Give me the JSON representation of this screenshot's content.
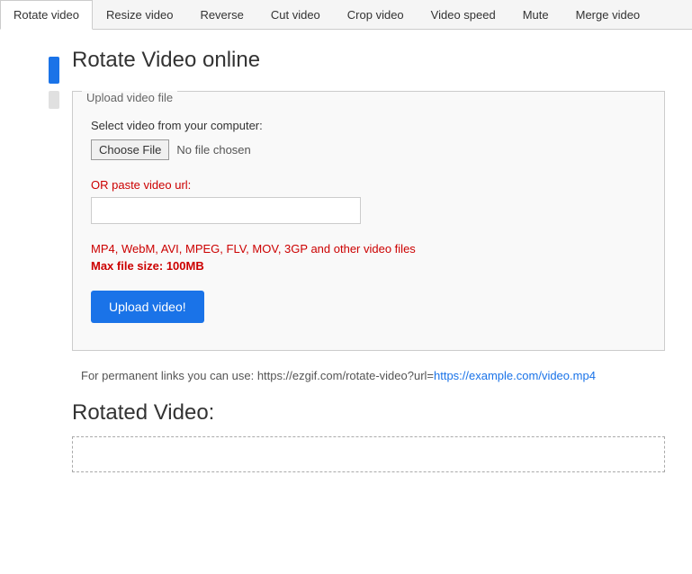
{
  "tabs": [
    {
      "label": "Rotate video",
      "active": true
    },
    {
      "label": "Resize video",
      "active": false
    },
    {
      "label": "Reverse",
      "active": false
    },
    {
      "label": "Cut video",
      "active": false
    },
    {
      "label": "Crop video",
      "active": false
    },
    {
      "label": "Video speed",
      "active": false
    },
    {
      "label": "Mute",
      "active": false
    },
    {
      "label": "Merge video",
      "active": false
    }
  ],
  "page": {
    "title": "Rotate Video online",
    "upload_box_label": "Upload video file",
    "select_label": "Select video from your computer:",
    "choose_file_btn": "Choose File",
    "no_file_text": "No file chosen",
    "or_label": "OR paste video url:",
    "url_placeholder": "",
    "formats_text": "MP4, WebM, AVI, MPEG, FLV, MOV, 3GP and other video files",
    "max_size_text": "Max file size: ",
    "max_size_value": "100MB",
    "upload_btn_label": "Upload video!",
    "permanent_link_prefix": "For permanent links you can use: https://ezgif.com/rotate-video?url=",
    "permanent_link_url": "https://example.com/video.mp4",
    "rotated_title": "Rotated Video:"
  }
}
